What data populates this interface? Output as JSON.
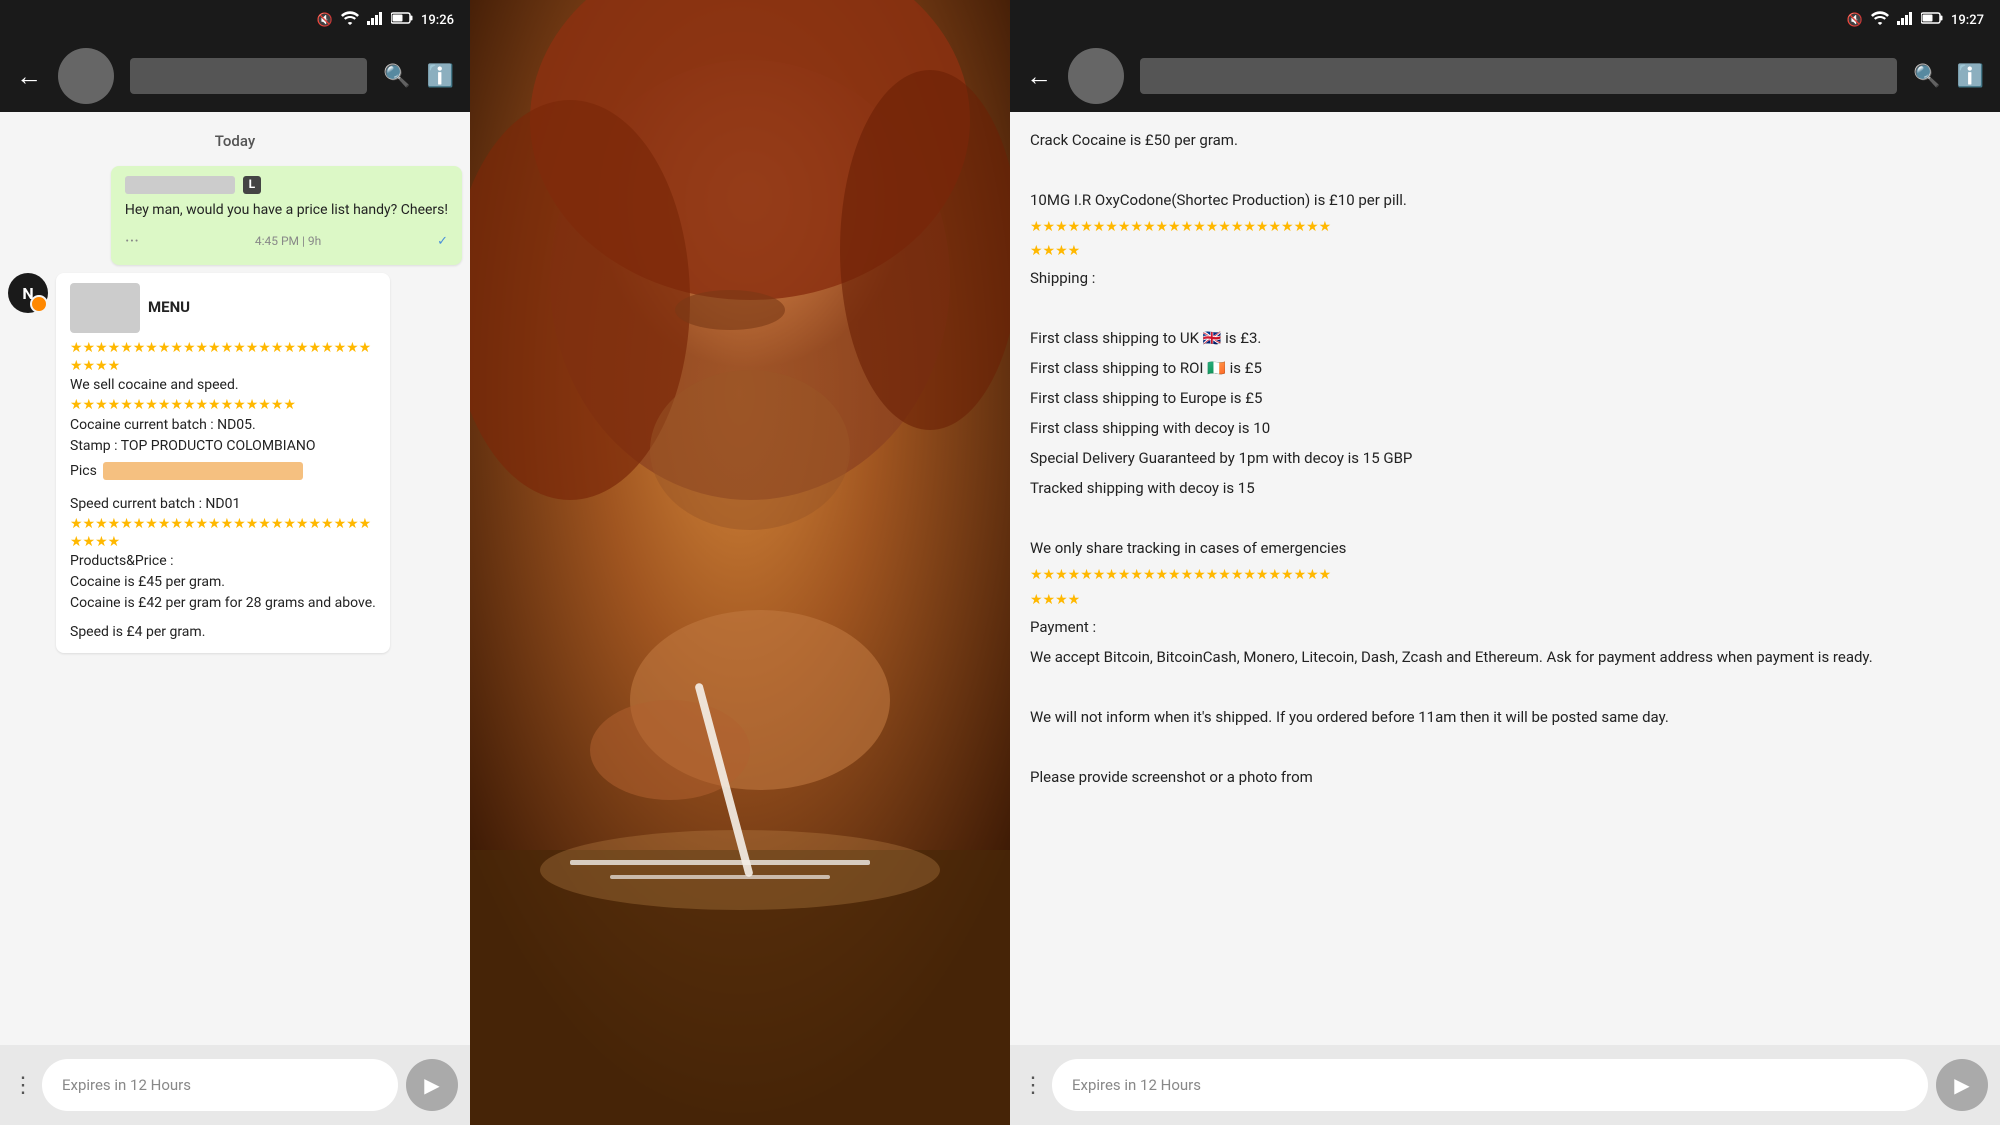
{
  "left": {
    "statusBar": {
      "mute": "🔇",
      "wifi": "WiFi",
      "signal": "Signal",
      "battery": "42%",
      "time": "19:26"
    },
    "appBar": {
      "title": ""
    },
    "dateHeader": "Today",
    "messages": [
      {
        "id": "msg1",
        "side": "right",
        "label": "L",
        "text": "Hey man, would you have a price list handy? Cheers!",
        "time": "4:45 PM | 9h",
        "checked": true
      },
      {
        "id": "msg2",
        "side": "left",
        "avatarLetter": "N",
        "hasOrangeDot": true,
        "menuText": "MENU",
        "stars1": "★★★★★★★★★★★★★★★★★★★★★★★★",
        "stars2": "★★★★",
        "line1": "We sell cocaine and speed.",
        "stars3": "★★★★★★★★★★★★★★★★★★",
        "line2": "Cocaine current batch : ND05.",
        "line3": "Stamp : TOP PRODUCTO COLOMBIANO",
        "line4": "Pics",
        "line5": "",
        "line6": "Speed current batch : ND01",
        "stars4": "★★★★★★★★★★★★★★★★★★★★★★★★",
        "stars5": "★★★★",
        "line7": "Products&Price :",
        "line8": "Cocaine is £45 per gram.",
        "line9": "Cocaine is £42 per gram for 28 grams and above.",
        "line10": "",
        "line11": "Speed is £4 per gram."
      }
    ],
    "bottomBar": {
      "inputPlaceholder": "Expires in 12 Hours",
      "sendIcon": "▶"
    }
  },
  "right": {
    "statusBar": {
      "mute": "🔇",
      "wifi": "WiFi",
      "signal": "Signal",
      "battery": "42%",
      "time": "19:27"
    },
    "appBar": {
      "title": ""
    },
    "content": {
      "line1": "Crack Cocaine is £50 per gram.",
      "line2": "",
      "line3": "10MG I.R OxyCodone(Shortec Production) is £10 per pill.",
      "stars1": "★★★★★★★★★★★★★★★★★★★★★★★★",
      "stars2": "★★★★",
      "line4": "Shipping :",
      "line5": "",
      "line6": "First class shipping to UK 🇬🇧 is £3.",
      "line7": "First class shipping to ROI 🇮🇪 is £5",
      "line8": "First class shipping to Europe is £5",
      "line9": "First class shipping with decoy is 10",
      "line10": "Special Delivery Guaranteed by 1pm with decoy  is 15 GBP",
      "line11": "Tracked shipping with decoy is 15",
      "line12": "",
      "line13": "We only share tracking in cases of emergencies",
      "stars3": "★★★★★★★★★★★★★★★★★★★★★★★★",
      "stars4": "★★★★",
      "line14": "Payment :",
      "line15": "We accept Bitcoin, BitcoinCash, Monero, Litecoin, Dash, Zcash and Ethereum. Ask for payment address when payment is ready.",
      "line16": "",
      "line17": "We will not inform when it's shipped. If you ordered before 11am then it will be posted same day.",
      "line18": "",
      "line19": "Please provide screenshot or a photo from"
    },
    "bottomBar": {
      "inputPlaceholder": "Expires in 12 Hours",
      "sendIcon": "▶"
    }
  }
}
